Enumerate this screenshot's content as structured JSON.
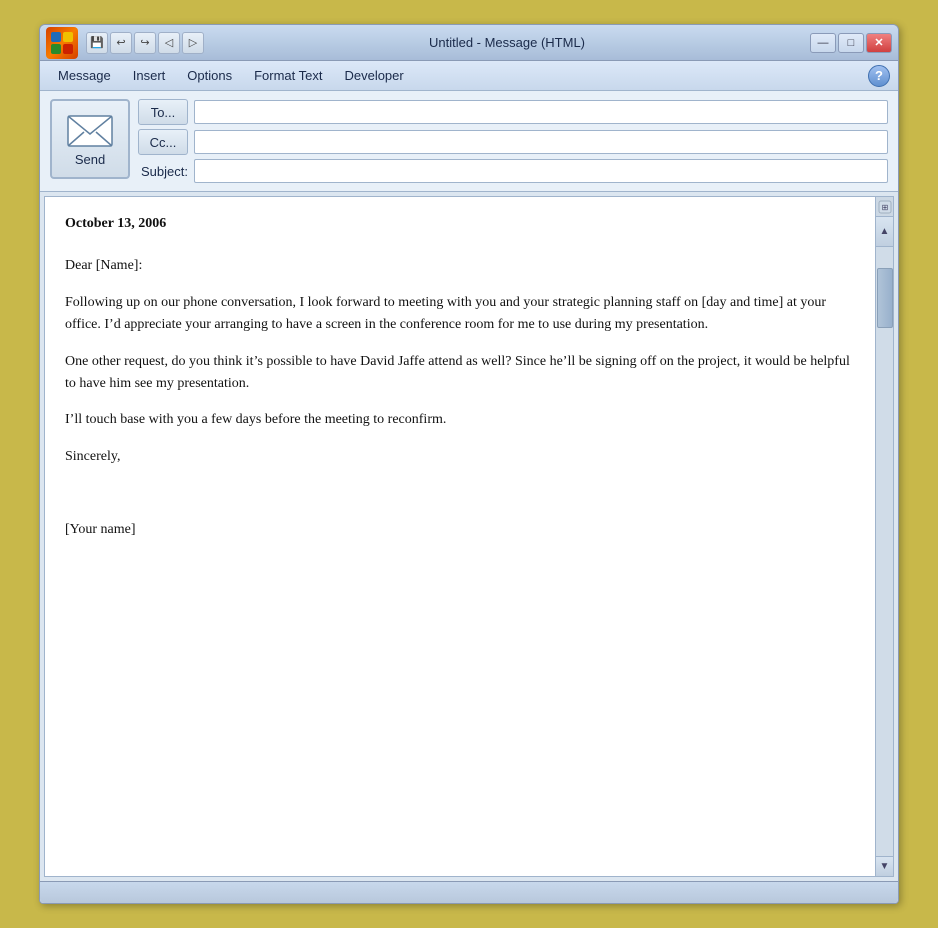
{
  "window": {
    "title": "Untitled - Message (HTML)",
    "title_prefix": "Untitled",
    "title_suffix": " - Message (HTML)"
  },
  "titlebar": {
    "save_label": "💾",
    "undo_label": "↩",
    "redo_label": "↪",
    "back_label": "◁",
    "forward_label": "▷",
    "minimize_label": "—",
    "maximize_label": "□",
    "close_label": "✕"
  },
  "menu": {
    "items": [
      "Message",
      "Insert",
      "Options",
      "Format Text",
      "Developer"
    ],
    "help": "?"
  },
  "header": {
    "send_label": "Send",
    "to_label": "To...",
    "cc_label": "Cc...",
    "subject_label": "Subject:",
    "to_value": "",
    "cc_value": "",
    "subject_value": ""
  },
  "body": {
    "date": "October 13, 2006",
    "salutation": "Dear [Name]:",
    "paragraph1": "Following up on our phone conversation, I look forward to meeting with you and your strategic planning staff on [day and time] at your office. I’d appreciate your arranging to have a screen in the conference room for me to use during my presentation.",
    "paragraph2": "One other request, do you think it’s possible to have David Jaffe attend as well? Since he’ll be signing off on the project, it would be helpful to have him see my presentation.",
    "paragraph3": "I’ll touch base with you a few days before the meeting to reconfirm.",
    "closing": "Sincerely,",
    "signature": "[Your name]"
  },
  "status": {
    "text": ""
  }
}
